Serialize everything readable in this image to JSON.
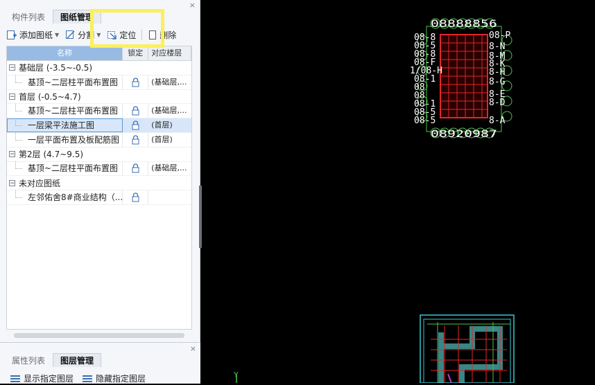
{
  "top_panel": {
    "tabs": [
      "构件列表",
      "图纸管理"
    ],
    "close": "×"
  },
  "toolbar": {
    "add": "添加图纸",
    "split": "分割",
    "locate": "定位",
    "delete": "删除"
  },
  "grid": {
    "columns": [
      "名称",
      "锁定",
      "对应楼层"
    ],
    "groups": [
      {
        "expand": "−",
        "label": "基础层 (-3.5~-0.5)",
        "rows": [
          {
            "name": "基顶~二层柱平面布置图",
            "floor": "(基础层,..."
          }
        ]
      },
      {
        "expand": "−",
        "label": "首层 (-0.5~4.7)",
        "rows": [
          {
            "name": "基顶~二层柱平面布置图",
            "floor": "(基础层,..."
          },
          {
            "name": "一层梁平法施工图",
            "floor": "(首层)"
          },
          {
            "name": "一层平面布置及板配筋图",
            "floor": "(首层)"
          }
        ]
      },
      {
        "expand": "−",
        "label": "第2层 (4.7~9.5)",
        "rows": [
          {
            "name": "基顶~二层柱平面布置图",
            "floor": "(基础层,..."
          }
        ]
      },
      {
        "expand": "−",
        "label": "未对应图纸",
        "rows": [
          {
            "name": "左邻佑舍8#商业结构（...",
            "floor": ""
          }
        ]
      }
    ],
    "selected": "一层梁平法施工图"
  },
  "bottom_panel": {
    "tabs": [
      "属性列表",
      "图层管理"
    ],
    "close": "×",
    "show_layer": "显示指定图层",
    "hide_layer": "隐藏指定图层"
  },
  "canvas": {
    "top_labels": "08888856",
    "bottom_labels": "08920987",
    "left_labels": [
      "08-8",
      "08-5",
      "08-8",
      "08-F",
      "1/08-H",
      "08-1",
      "08",
      "08",
      "08-1",
      "08-5",
      "08-5"
    ],
    "right_labels": [
      "08-P",
      "8-N",
      "8-M",
      "8-K",
      "8-H",
      "8-G",
      "8-E",
      "8-D",
      "8-A"
    ],
    "axis_y": "Y",
    "colors": {
      "grid": "#e02828",
      "bubble": "#4ec24e",
      "frame": "#37c7d0",
      "text": "#ffffff",
      "highlight": "#fbf05a"
    }
  }
}
